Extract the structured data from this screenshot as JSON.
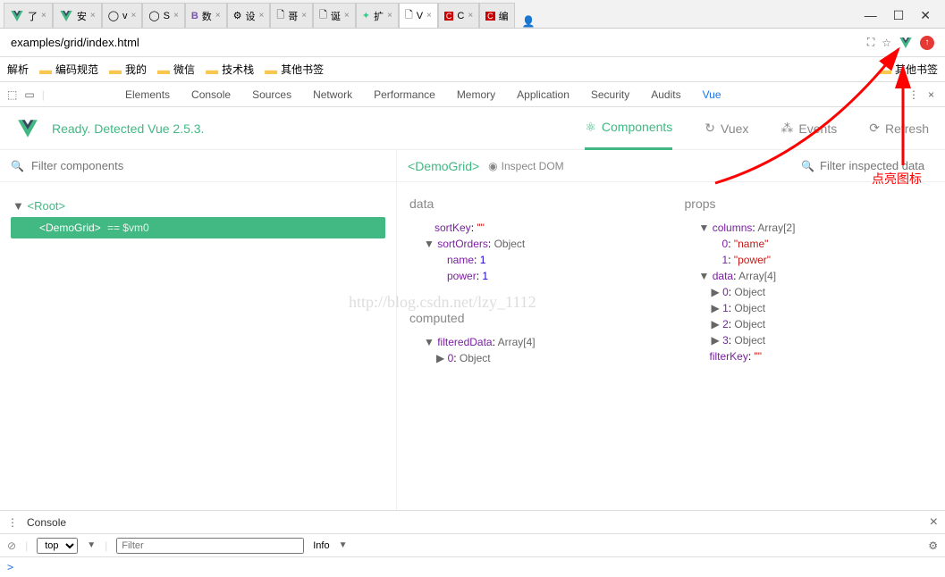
{
  "browser": {
    "tabs": [
      {
        "icon": "vue",
        "label": "了",
        "active": false
      },
      {
        "icon": "vue",
        "label": "安",
        "active": false
      },
      {
        "icon": "github",
        "label": "v",
        "active": false
      },
      {
        "icon": "github",
        "label": "S",
        "active": false
      },
      {
        "icon": "b",
        "label": "数",
        "active": false
      },
      {
        "icon": "gear",
        "label": "设",
        "active": false
      },
      {
        "icon": "doc",
        "label": "哥",
        "active": false
      },
      {
        "icon": "doc",
        "label": "诞",
        "active": false
      },
      {
        "icon": "ext",
        "label": "扩",
        "active": false
      },
      {
        "icon": "doc",
        "label": "V",
        "active": true
      },
      {
        "icon": "c",
        "label": "C",
        "active": false
      },
      {
        "icon": "c",
        "label": "编",
        "active": false
      }
    ],
    "url": "examples/grid/index.html",
    "bookmarks": [
      "解析",
      "编码规范",
      "我的",
      "微信",
      "技术栈",
      "其他书签"
    ],
    "other_bookmarks": "其他书签"
  },
  "devtools_tabs": [
    "Elements",
    "Console",
    "Sources",
    "Network",
    "Performance",
    "Memory",
    "Application",
    "Security",
    "Audits",
    "Vue"
  ],
  "devtools_active": "Vue",
  "vue": {
    "status": "Ready. Detected Vue 2.5.3.",
    "nav": [
      {
        "label": "Components",
        "icon": "components"
      },
      {
        "label": "Vuex",
        "icon": "vuex"
      },
      {
        "label": "Events",
        "icon": "events"
      },
      {
        "label": "Refresh",
        "icon": "refresh"
      }
    ],
    "nav_active": "Components",
    "filter_placeholder": "Filter components",
    "selected_component": "DemoGrid",
    "inspect_dom": "Inspect DOM",
    "filter_inspected_placeholder": "Filter inspected data",
    "tree": {
      "root": "Root",
      "selected": "DemoGrid",
      "vm": "== $vm0"
    },
    "data_section": "data",
    "data_items": {
      "sortKey": "\"\"",
      "sortOrders": "Object",
      "sortOrders_children": [
        {
          "k": "name",
          "v": "1"
        },
        {
          "k": "power",
          "v": "1"
        }
      ]
    },
    "computed_section": "computed",
    "computed_items": {
      "filteredData": "Array[4]",
      "children": [
        {
          "k": "0",
          "v": "Object"
        }
      ]
    },
    "props_section": "props",
    "props_items": {
      "columns": "Array[2]",
      "columns_children": [
        {
          "k": "0",
          "v": "\"name\""
        },
        {
          "k": "1",
          "v": "\"power\""
        }
      ],
      "data": "Array[4]",
      "data_children": [
        {
          "k": "0",
          "v": "Object"
        },
        {
          "k": "1",
          "v": "Object"
        },
        {
          "k": "2",
          "v": "Object"
        },
        {
          "k": "3",
          "v": "Object"
        }
      ],
      "filterKey": "\"\""
    }
  },
  "console": {
    "title": "Console",
    "context": "top",
    "filter_placeholder": "Filter",
    "level": "Info",
    "prompt": ">"
  },
  "watermark": "http://blog.csdn.net/lzy_1112",
  "annotation": "点亮图标"
}
